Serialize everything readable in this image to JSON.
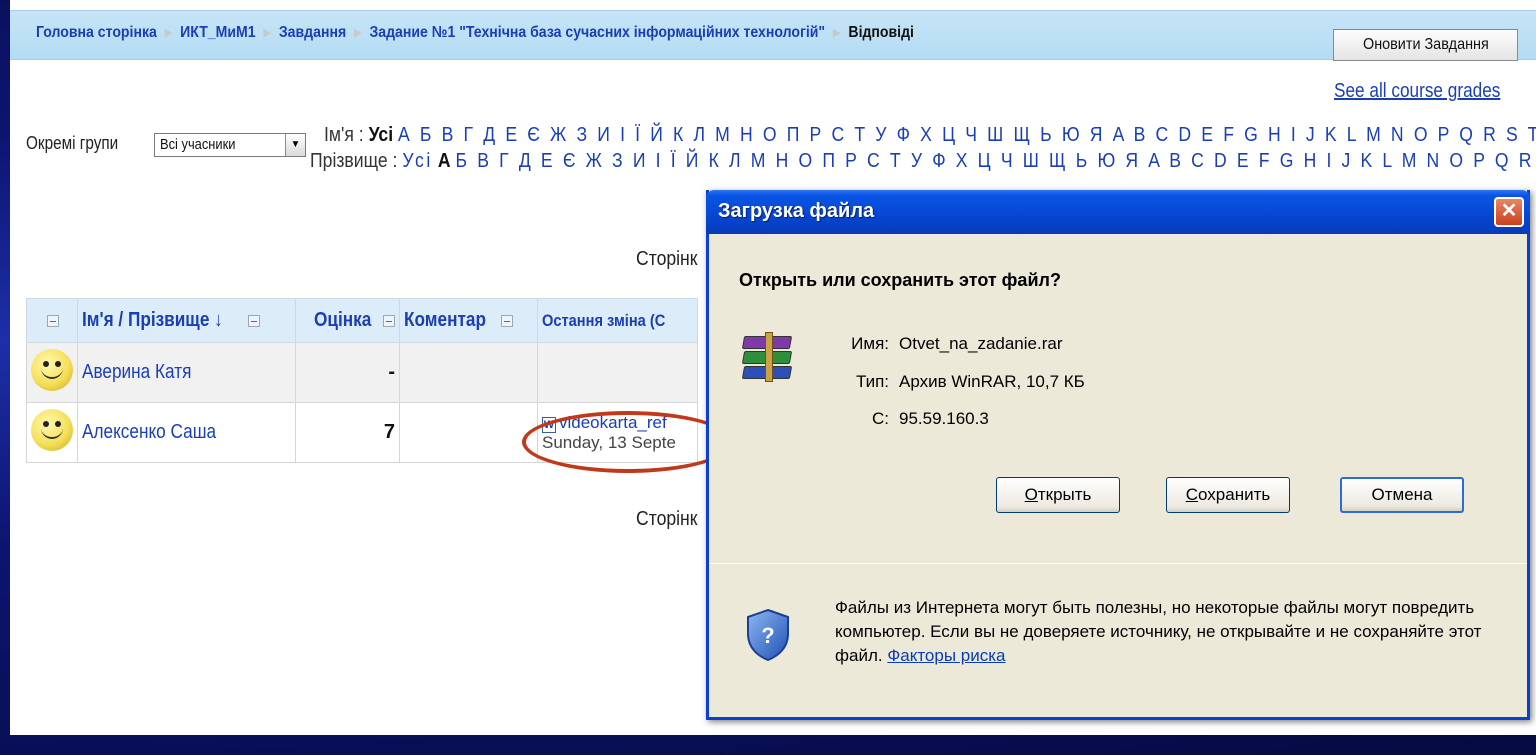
{
  "breadcrumb": {
    "items": [
      "Головна сторінка",
      "ИКТ_МиМ1",
      "Завдання",
      "Задание №1 \"Технічна база сучасних інформаційних технологій\""
    ],
    "current": "Відповіді"
  },
  "update_button": "Оновити Завдання",
  "see_grades": "See all course grades",
  "groups": {
    "label": "Окремі групи",
    "selected": "Всі учасники"
  },
  "first_name_filter": {
    "label": "Ім'я :",
    "all": "Усі",
    "letters": "А Б В Г Д Е Є Ж З И І Ї Й К Л М Н О П Р С Т У Ф Х Ц Ч Ш Щ Ь Ю Я A B C D E F G H I J K L M N O P Q R S T U V W X Y Z"
  },
  "last_name_filter": {
    "label": "Прізвище :",
    "all": "Усі",
    "active": "А",
    "letters": "Б В Г Д Е Є Ж З И І Ї Й К Л М Н О П Р С Т У Ф Х Ц Ч Ш Щ Ь Ю Я A B C D E F G H I J K L M N O P Q R S T U V W X Y Z"
  },
  "page_label": "Сторінк",
  "table": {
    "headers": [
      "Ім'я / Прізвище ↓",
      "Оцінка",
      "Коментар",
      "Остання зміна (С"
    ],
    "rows": [
      {
        "name": "Аверина Катя",
        "grade": "-",
        "comment": "",
        "file": "",
        "date": ""
      },
      {
        "name": "Алексенко Саша",
        "grade": "7",
        "comment": "",
        "file": "videokarta_ref",
        "date": "Sunday, 13 Septe"
      }
    ]
  },
  "dialog": {
    "title": "Загрузка файла",
    "question": "Открыть или сохранить этот файл?",
    "name_label": "Имя:",
    "name_value": "Otvet_na_zadanie.rar",
    "type_label": "Тип:",
    "type_value": "Архив WinRAR, 10,7 КБ",
    "from_label": "С:",
    "from_value": "95.59.160.3",
    "open_button": {
      "key": "О",
      "rest": "ткрыть"
    },
    "save_button": {
      "key": "С",
      "rest": "охранить"
    },
    "cancel_button": "Отмена",
    "warning": "Файлы из Интернета могут быть полезны, но некоторые файлы могут повредить компьютер. Если вы не доверяете источнику, не открывайте и не сохраняйте этот файл.",
    "risk_link": "Факторы риска"
  },
  "colors": {
    "link": "#1a3fb5",
    "titlebar": "#0746d1",
    "highlight_ellipse": "#c0391b"
  }
}
